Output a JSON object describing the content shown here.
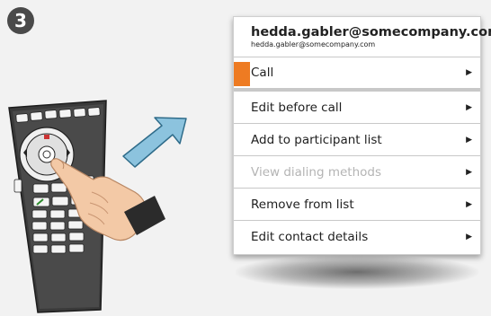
{
  "step": {
    "number": "3"
  },
  "menu": {
    "title": "hedda.gabler@somecompany.com",
    "subtitle": "hedda.gabler@somecompany.com",
    "items": [
      {
        "label": "Call",
        "selected": true,
        "enabled": true
      },
      {
        "label": "Edit before call",
        "selected": false,
        "enabled": true
      },
      {
        "label": "Add to participant list",
        "selected": false,
        "enabled": true
      },
      {
        "label": "View dialing methods",
        "selected": false,
        "enabled": false
      },
      {
        "label": "Remove from list",
        "selected": false,
        "enabled": true
      },
      {
        "label": "Edit contact details",
        "selected": false,
        "enabled": true
      }
    ],
    "arrow_glyph": "▶"
  },
  "colors": {
    "accent": "#ee7b22",
    "disabled_text": "#b4b4b4",
    "remote_body": "#3a3a3a",
    "arrow_fill": "#8cc3de"
  },
  "icons": {
    "remote": "remote-control-icon",
    "hand": "pointing-hand-icon",
    "direction": "direction-arrow-icon"
  }
}
